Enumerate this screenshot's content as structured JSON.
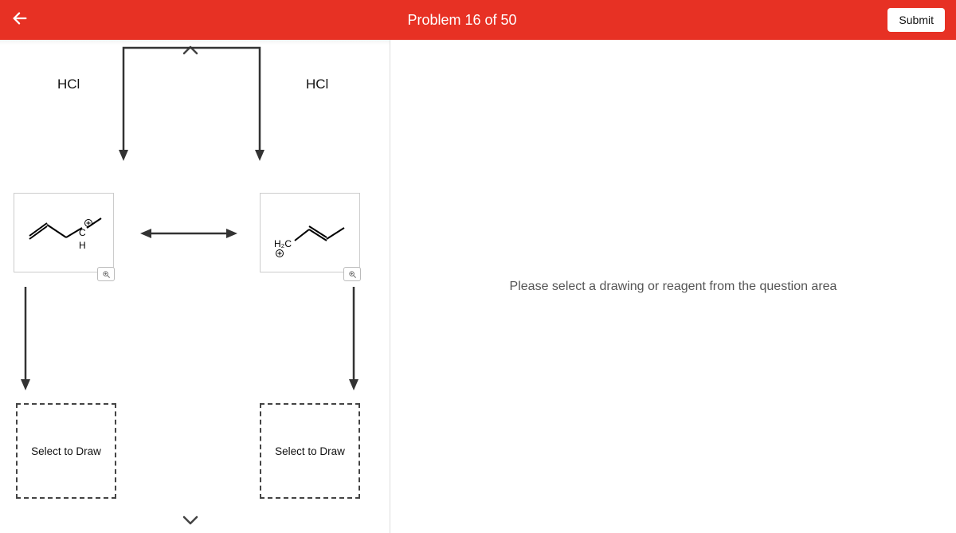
{
  "header": {
    "title": "Problem 16 of 50",
    "submit_label": "Submit"
  },
  "right_panel": {
    "message": "Please select a drawing or reagent from the question area"
  },
  "reagents": {
    "left_reagent": "HCl",
    "right_reagent": "HCl"
  },
  "structures": {
    "left": {
      "c_label": "C",
      "h_label": "H"
    },
    "right": {
      "ch2_label": "H₂C"
    }
  },
  "draw_boxes": {
    "left_label": "Select to Draw",
    "right_label": "Select to Draw"
  }
}
